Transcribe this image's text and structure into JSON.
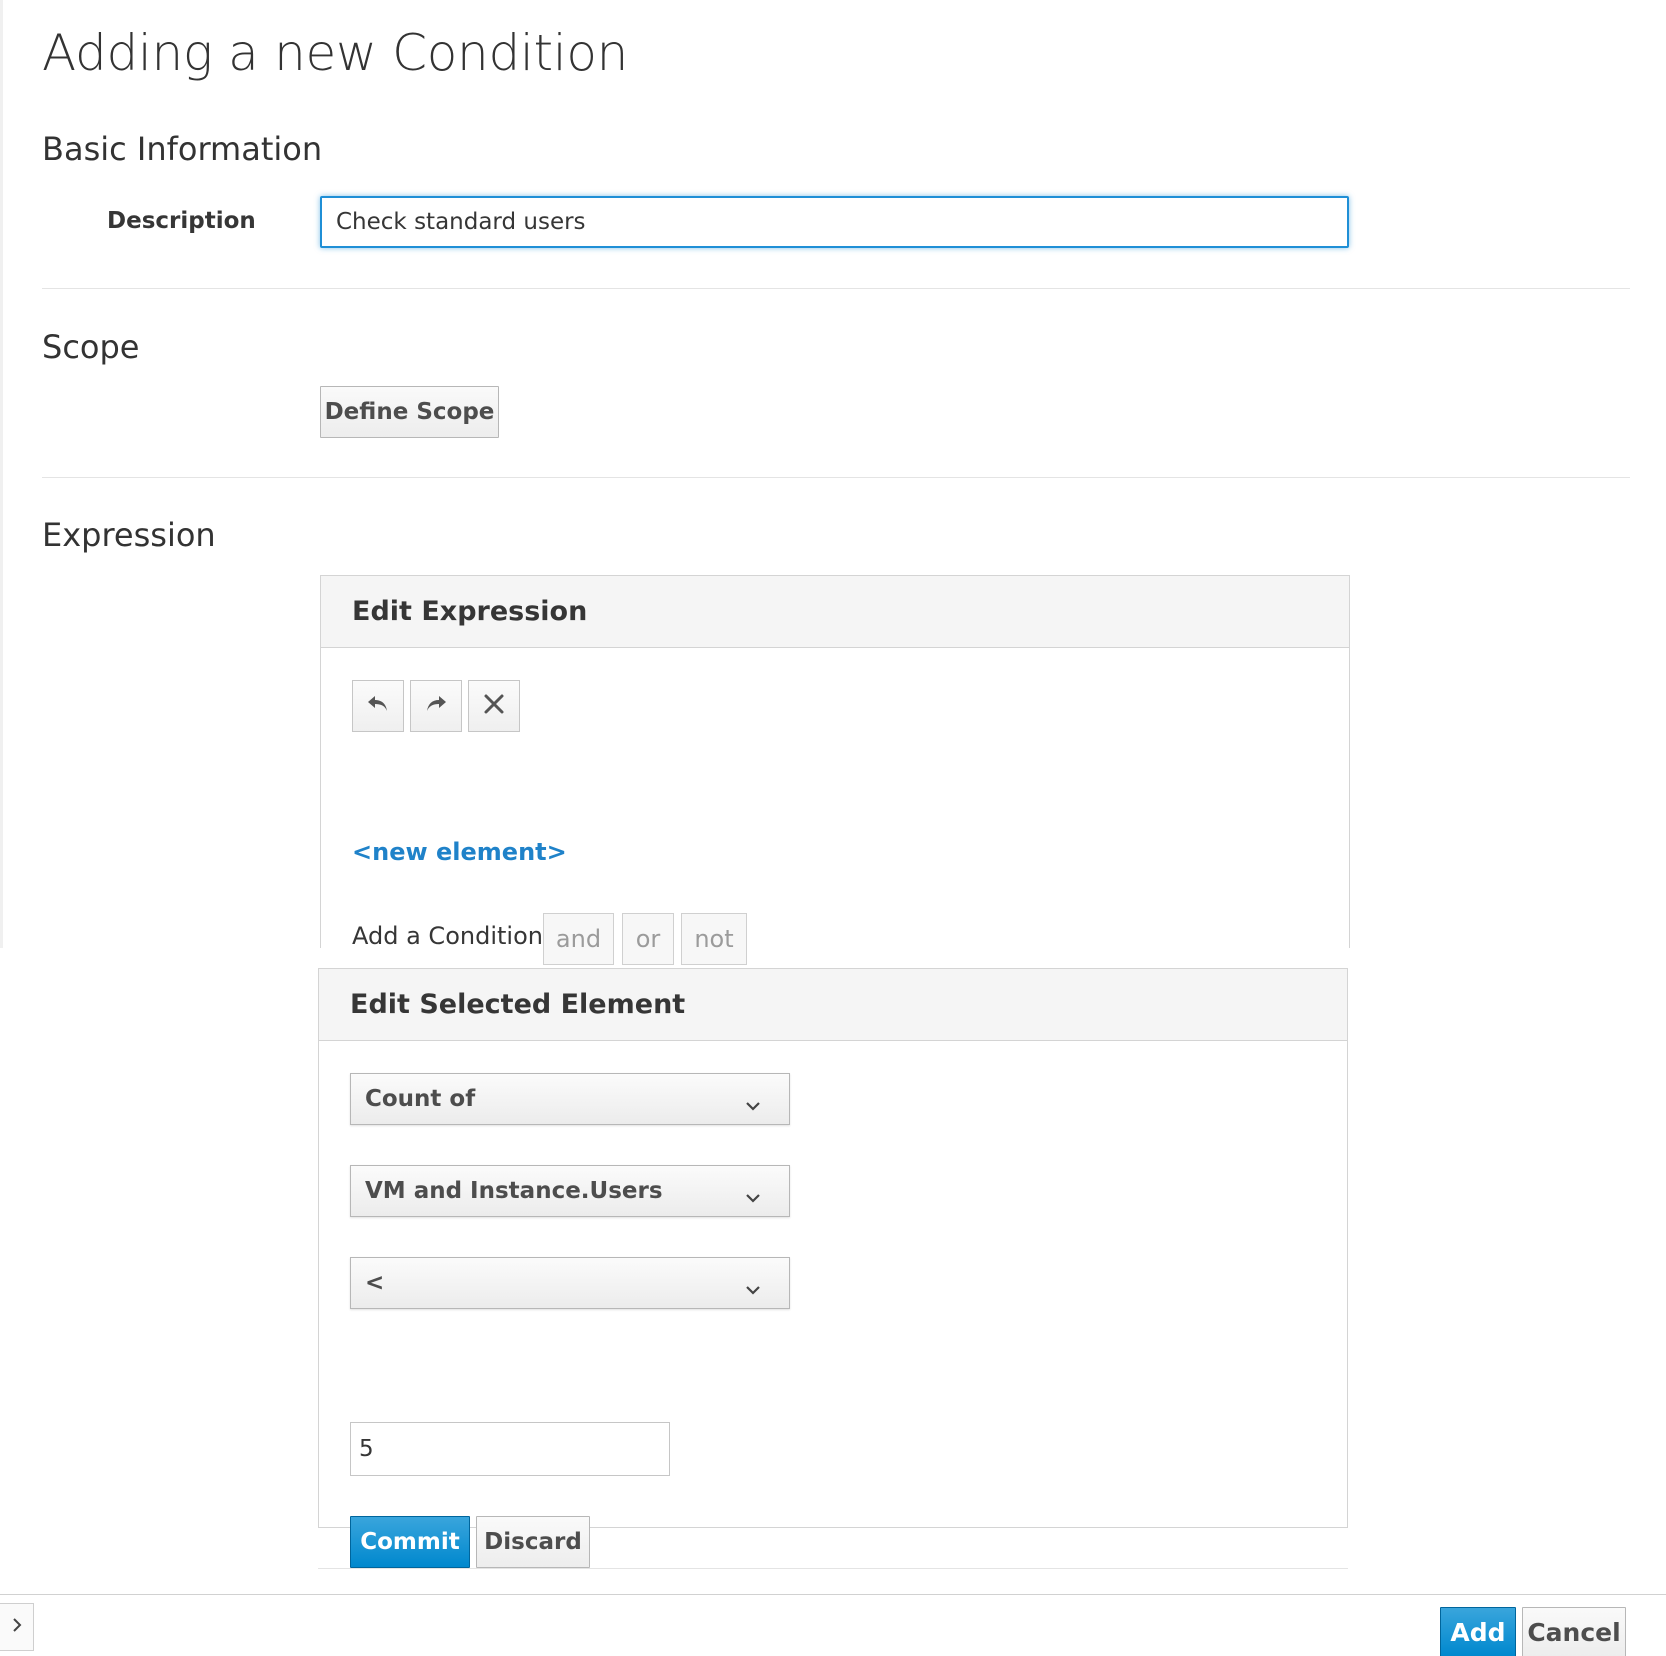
{
  "page": {
    "title": "Adding a new Condition"
  },
  "basic_info": {
    "heading": "Basic Information",
    "description_label": "Description",
    "description_value": "Check standard users"
  },
  "scope": {
    "heading": "Scope",
    "define_button": "Define Scope"
  },
  "expression": {
    "heading": "Expression",
    "panel_title": "Edit Expression",
    "toolbar": {
      "undo_icon": "undo-icon",
      "redo_icon": "redo-icon",
      "clear_icon": "close-icon"
    },
    "new_element_link": "<new element>",
    "add_condition_label": "Add a Condition:",
    "logic_buttons": [
      "and",
      "or",
      "not"
    ]
  },
  "selected_element": {
    "panel_title": "Edit Selected Element",
    "selects": [
      {
        "value": "Count of"
      },
      {
        "value": "VM and Instance.Users"
      },
      {
        "value": "<"
      }
    ],
    "value_input": "5",
    "commit_label": "Commit",
    "discard_label": "Discard"
  },
  "footer": {
    "add_label": "Add",
    "cancel_label": "Cancel",
    "drawer_icon": "chevron-right-icon"
  },
  "colors": {
    "accent": "#0088ce",
    "link": "#1f82c9",
    "focus_border": "#1f8fd6"
  }
}
